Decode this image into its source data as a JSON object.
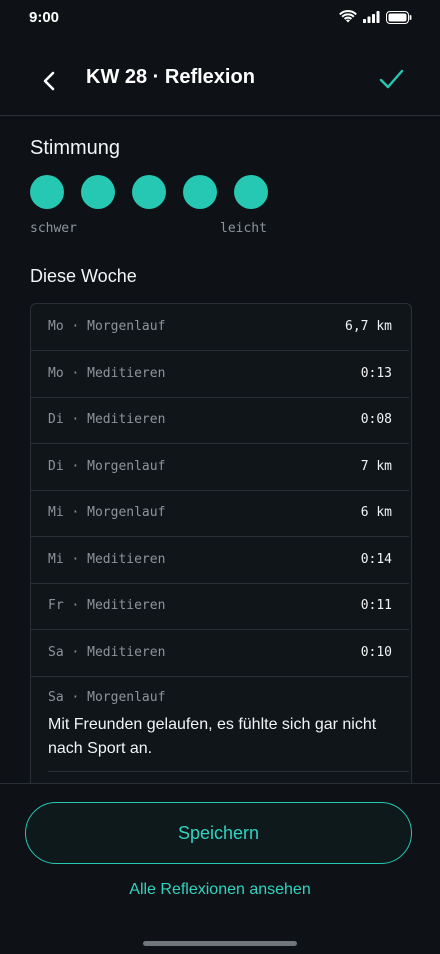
{
  "status_bar": {
    "time": "9:00"
  },
  "header": {
    "title": "KW 28 · Reflexion"
  },
  "mood": {
    "section_title": "Stimmung",
    "selected_level": 5,
    "max_level": 5,
    "low_label": "schwer",
    "high_label": "leicht"
  },
  "week": {
    "section_title": "Diese Woche",
    "entries": [
      {
        "label": "Mo · Morgenlauf",
        "value": "6,7 km"
      },
      {
        "label": "Mo · Meditieren",
        "value": "0:13"
      },
      {
        "label": "Di · Meditieren",
        "value": "0:08"
      },
      {
        "label": "Di · Morgenlauf",
        "value": "7 km"
      },
      {
        "label": "Mi · Morgenlauf",
        "value": "6 km"
      },
      {
        "label": "Mi · Meditieren",
        "value": "0:14"
      },
      {
        "label": "Fr · Meditieren",
        "value": "0:11"
      },
      {
        "label": "Sa · Meditieren",
        "value": "0:10"
      }
    ],
    "note_entry": {
      "label": "Sa · Morgenlauf",
      "text": "Mit Freunden gelaufen, es fühlte sich gar nicht nach Sport an."
    }
  },
  "actions": {
    "save_label": "Speichern",
    "all_reflections_label": "Alle Reflexionen ansehen"
  },
  "colors": {
    "accent": "#26c7b3",
    "background": "#0e1216"
  }
}
